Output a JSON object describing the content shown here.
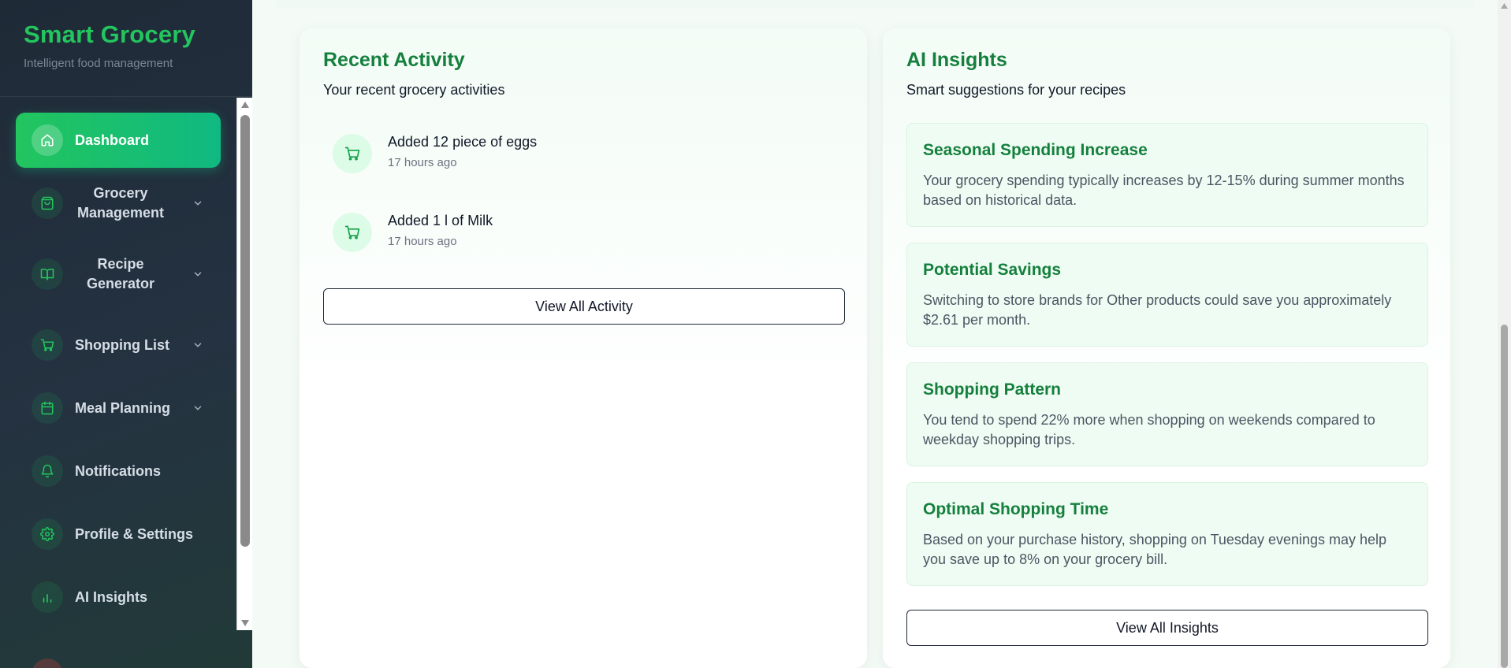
{
  "brand": {
    "title": "Smart Grocery",
    "subtitle": "Intelligent food management"
  },
  "sidebar": {
    "items": [
      {
        "label": "Dashboard",
        "icon": "home-icon",
        "active": true
      },
      {
        "label": "Grocery Management",
        "icon": "shopping-bag-icon",
        "expandable": true
      },
      {
        "label": "Recipe Generator",
        "icon": "book-icon",
        "expandable": true
      },
      {
        "label": "Shopping List",
        "icon": "cart-icon",
        "expandable": true
      },
      {
        "label": "Meal Planning",
        "icon": "calendar-icon",
        "expandable": true
      },
      {
        "label": "Notifications",
        "icon": "bell-icon"
      },
      {
        "label": "Profile & Settings",
        "icon": "gear-icon"
      },
      {
        "label": "AI Insights",
        "icon": "bar-chart-icon"
      }
    ]
  },
  "activity": {
    "title": "Recent Activity",
    "subtitle": "Your recent grocery activities",
    "items": [
      {
        "title": "Added 12 piece of eggs",
        "time": "17 hours ago"
      },
      {
        "title": "Added 1 l of Milk",
        "time": "17 hours ago"
      }
    ],
    "button_label": "View All Activity"
  },
  "insights": {
    "title": "AI Insights",
    "subtitle": "Smart suggestions for your recipes",
    "items": [
      {
        "title": "Seasonal Spending Increase",
        "body": "Your grocery spending typically increases by 12-15% during summer months based on historical data."
      },
      {
        "title": "Potential Savings",
        "body": "Switching to store brands for Other products could save you approximately $2.61 per month."
      },
      {
        "title": "Shopping Pattern",
        "body": "You tend to spend 22% more when shopping on weekends compared to weekday shopping trips."
      },
      {
        "title": "Optimal Shopping Time",
        "body": "Based on your purchase history, shopping on Tuesday evenings may help you save up to 8% on your grocery bill."
      }
    ],
    "button_label": "View All Insights"
  },
  "colors": {
    "accent": "#22c55e",
    "accent_dark": "#15803d",
    "sidebar_bg": "#1f2a37",
    "insight_bg": "#effcf3"
  }
}
